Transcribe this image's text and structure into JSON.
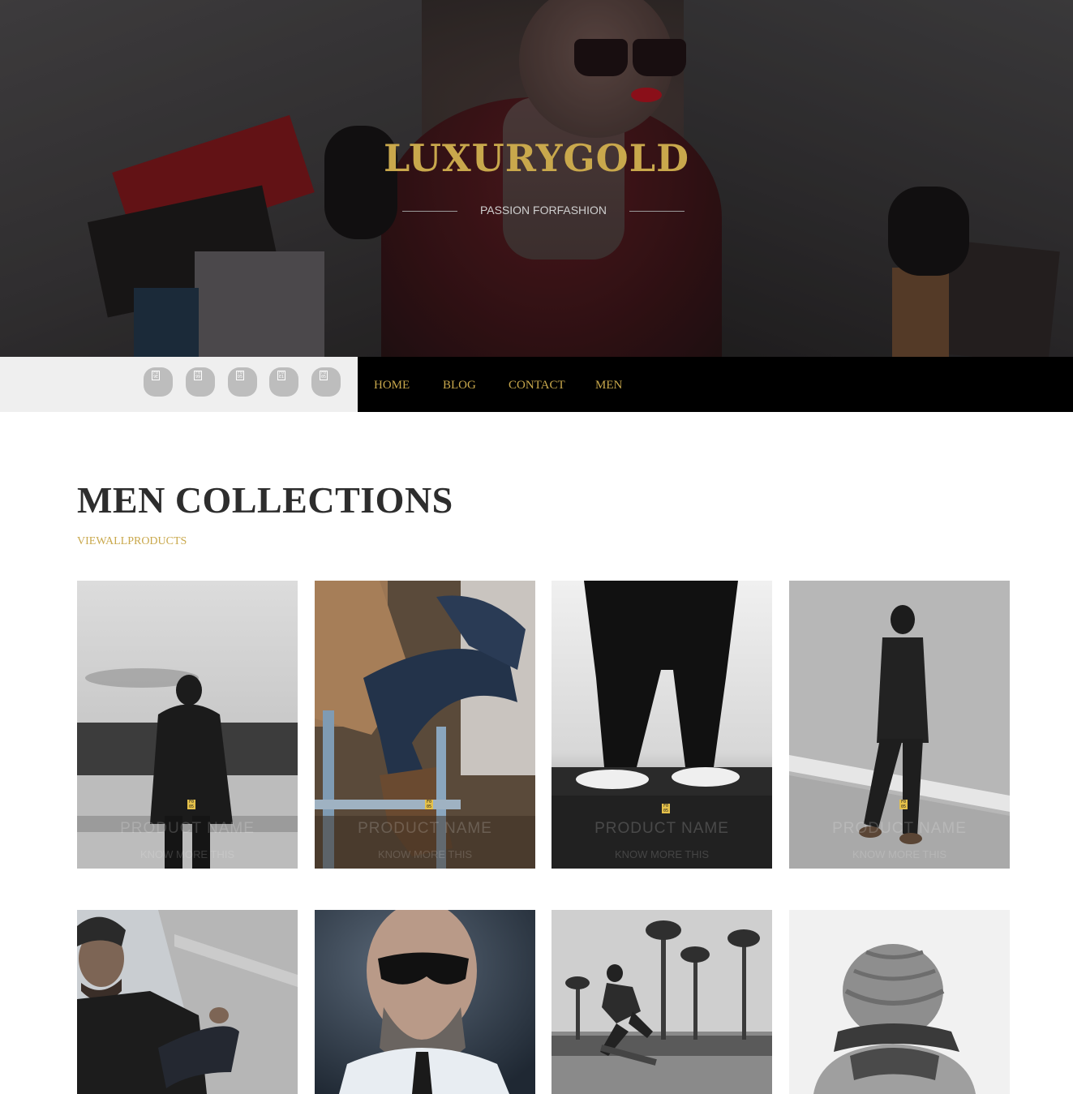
{
  "hero": {
    "brand": "LUXURYGOLD",
    "tagline": "PASSION FORFASHION"
  },
  "social": {
    "icons": [
      {
        "icon": "facebook-icon",
        "glyph": "F0 9E"
      },
      {
        "icon": "twitter-icon",
        "glyph": "F0 99"
      },
      {
        "icon": "google-plus-icon",
        "glyph": "F0 D5"
      },
      {
        "icon": "linkedin-icon",
        "glyph": "F0 E1"
      },
      {
        "icon": "instagram-icon",
        "glyph": "F0 05"
      }
    ]
  },
  "nav": {
    "items": [
      "HOME",
      "BLOG",
      "CONTACT",
      "MEN"
    ]
  },
  "collection": {
    "title": "MEN COLLECTIONS",
    "view_all": "VIEWALLPRODUCTS",
    "icon_glyph": "F0 05",
    "products": [
      {
        "name": "PRODUCT NAME",
        "link": "KNOW MORE THIS",
        "scene": "man-by-lake"
      },
      {
        "name": "PRODUCT NAME",
        "link": "KNOW MORE THIS",
        "scene": "denim-boots"
      },
      {
        "name": "PRODUCT NAME",
        "link": "KNOW MORE THIS",
        "scene": "sneakers"
      },
      {
        "name": "PRODUCT NAME",
        "link": "KNOW MORE THIS",
        "scene": "man-walking"
      },
      {
        "name": "",
        "link": "",
        "scene": "bearded-man"
      },
      {
        "name": "",
        "link": "",
        "scene": "man-sunglasses"
      },
      {
        "name": "",
        "link": "",
        "scene": "skateboarder"
      },
      {
        "name": "",
        "link": "",
        "scene": "knit-beanie"
      }
    ]
  },
  "colors": {
    "gold": "#c9a84c",
    "nav_bg": "#000000",
    "social_bg": "#efefef"
  }
}
